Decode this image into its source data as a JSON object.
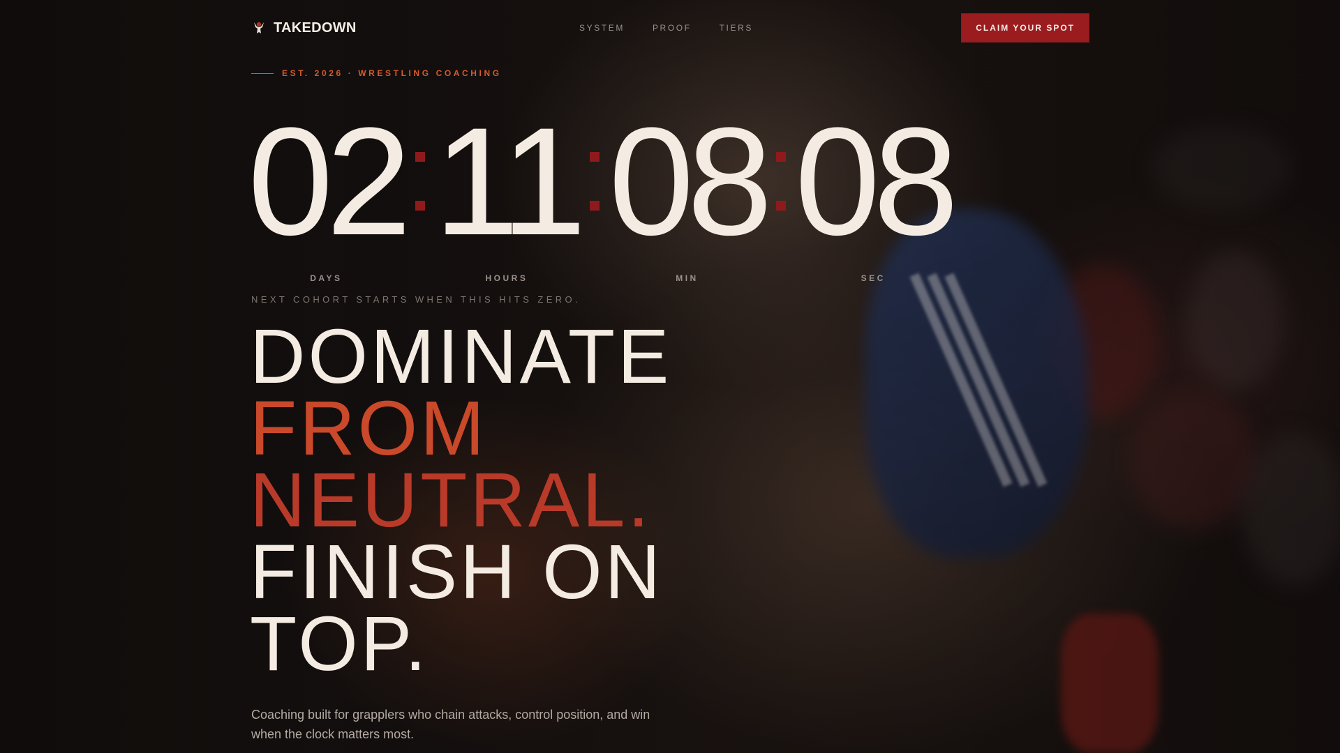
{
  "nav": {
    "brand": "TAKEDOWN",
    "links": [
      "SYSTEM",
      "PROOF",
      "TIERS"
    ],
    "cta": "CLAIM YOUR SPOT"
  },
  "eyebrow": "EST. 2026 · WRESTLING COACHING",
  "countdown": {
    "days": "02",
    "hours": "11",
    "minutes": "08",
    "seconds": "08",
    "labels": {
      "days": "DAYS",
      "hours": "HOURS",
      "minutes": "MIN",
      "seconds": "SEC"
    }
  },
  "cohort_note": "NEXT COHORT STARTS WHEN THIS HITS ZERO.",
  "headline": {
    "line1": "DOMINATE",
    "line2": "FROM",
    "line3": "NEUTRAL.",
    "line4": "FINISH ON",
    "line5": "TOP."
  },
  "subtext": "Coaching built for grapplers who chain attacks, control position, and win when the clock matters most.",
  "colors": {
    "accent": "#c9492a",
    "cta_bg": "#9b1c1f",
    "separator": "#8e1a1c",
    "text": "#f4ece2"
  },
  "icons": {
    "brand": "wrestler-icon"
  }
}
